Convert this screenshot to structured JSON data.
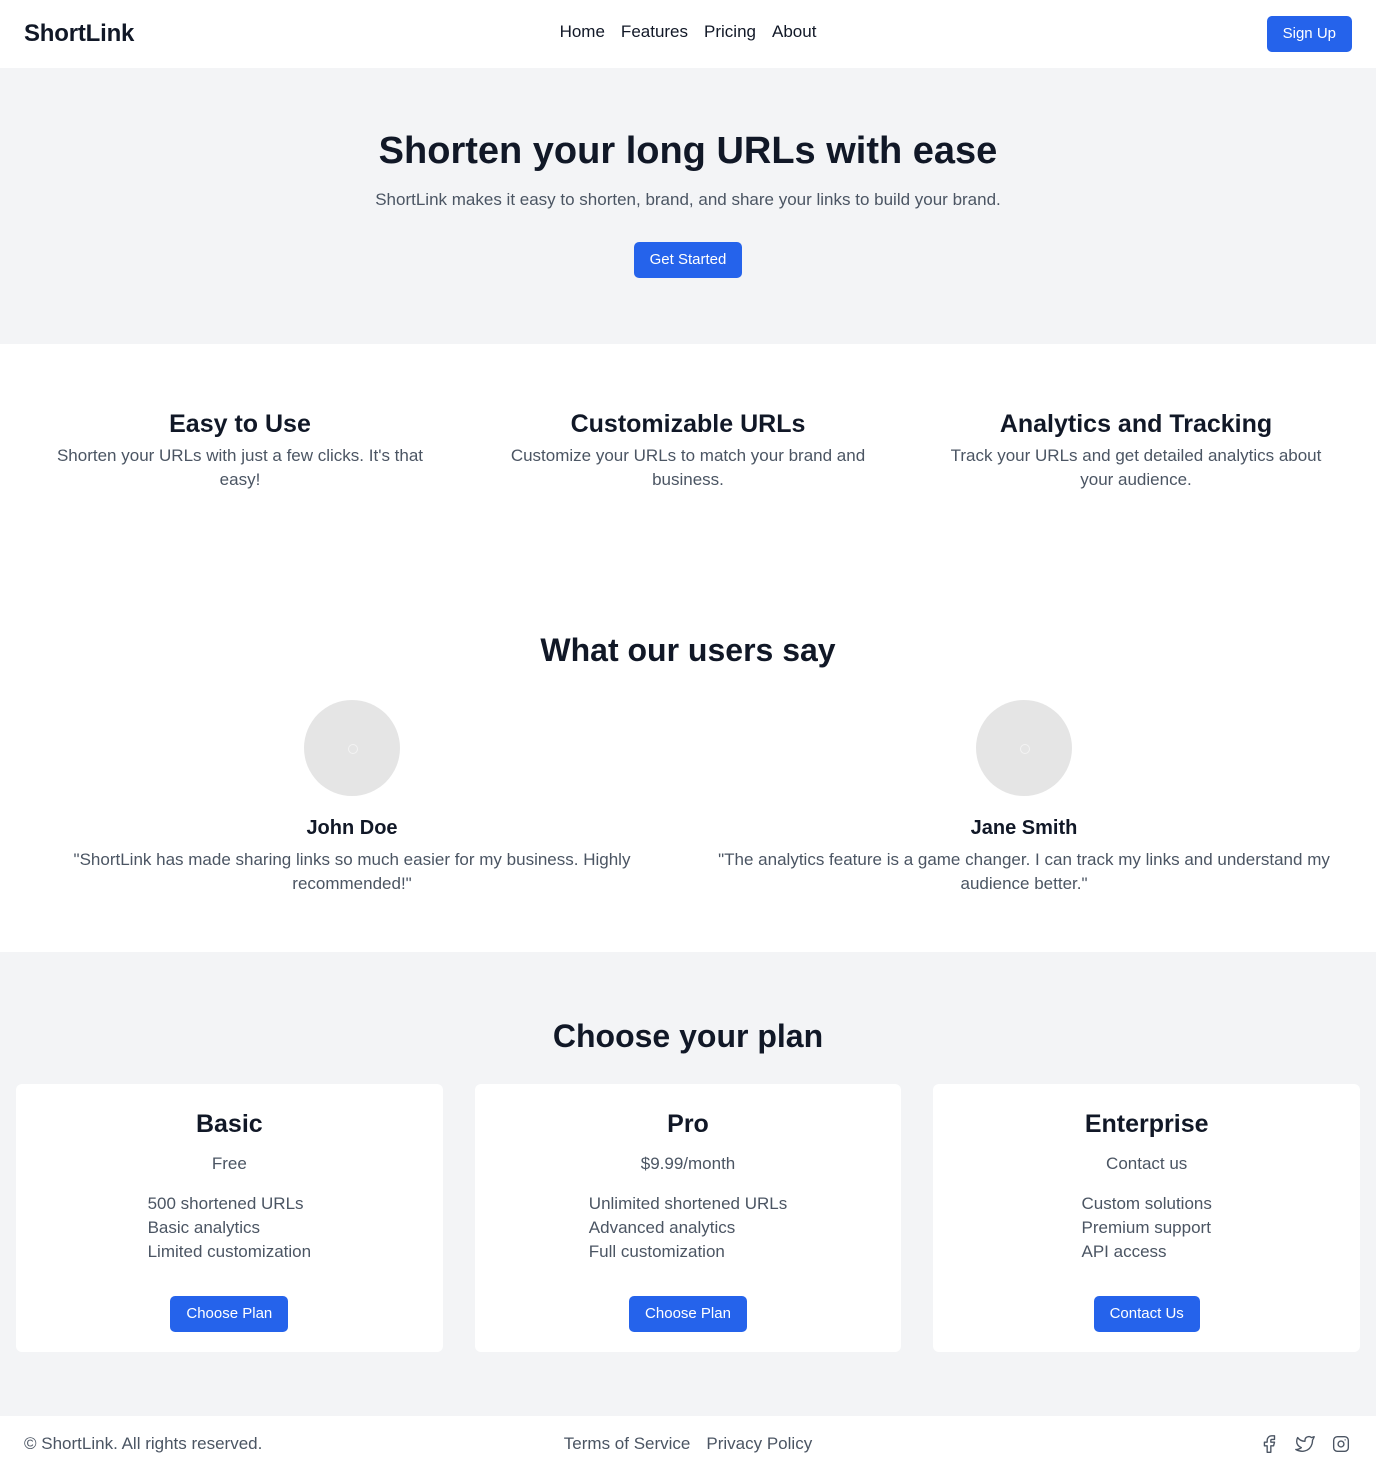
{
  "header": {
    "logo": "ShortLink",
    "nav": [
      "Home",
      "Features",
      "Pricing",
      "About"
    ],
    "signup_label": "Sign Up"
  },
  "hero": {
    "title": "Shorten your long URLs with ease",
    "subtitle": "ShortLink makes it easy to shorten, brand, and share your links to build your brand.",
    "cta_label": "Get Started"
  },
  "features": [
    {
      "title": "Easy to Use",
      "description": "Shorten your URLs with just a few clicks. It's that easy!"
    },
    {
      "title": "Customizable URLs",
      "description": "Customize your URLs to match your brand and business."
    },
    {
      "title": "Analytics and Tracking",
      "description": "Track your URLs and get detailed analytics about your audience."
    }
  ],
  "testimonials": {
    "title": "What our users say",
    "items": [
      {
        "name": "John Doe",
        "quote": "\"ShortLink has made sharing links so much easier for my business. Highly recommended!\""
      },
      {
        "name": "Jane Smith",
        "quote": "\"The analytics feature is a game changer. I can track my links and understand my audience better.\""
      }
    ]
  },
  "pricing": {
    "title": "Choose your plan",
    "plans": [
      {
        "name": "Basic",
        "price": "Free",
        "features": [
          "500 shortened URLs",
          "Basic analytics",
          "Limited customization"
        ],
        "button": "Choose Plan"
      },
      {
        "name": "Pro",
        "price": "$9.99/month",
        "features": [
          "Unlimited shortened URLs",
          "Advanced analytics",
          "Full customization"
        ],
        "button": "Choose Plan"
      },
      {
        "name": "Enterprise",
        "price": "Contact us",
        "features": [
          "Custom solutions",
          "Premium support",
          "API access"
        ],
        "button": "Contact Us"
      }
    ]
  },
  "footer": {
    "copyright": "© ShortLink. All rights reserved.",
    "links": [
      "Terms of Service",
      "Privacy Policy"
    ],
    "social_icons": [
      "facebook-icon",
      "twitter-icon",
      "instagram-icon"
    ]
  },
  "colors": {
    "accent": "#2563eb",
    "section_bg": "#f3f4f6",
    "text_dark": "#111827",
    "text_muted": "#4b5563"
  }
}
